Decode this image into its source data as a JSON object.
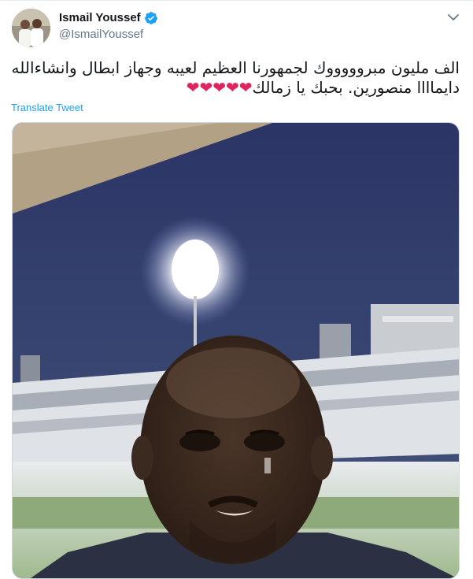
{
  "tweet": {
    "author": {
      "display_name": "Ismail Youssef",
      "handle": "@IsmailYoussef",
      "verified": true,
      "verified_icon": "verified-badge-icon"
    },
    "text_line1": "الف مليون مبروووووك لجمهورنا العظيم لعيبه وجهاز ابطال وانشاءالله",
    "text_line2": "دايماااا منصورين. بحبك يا زمالك",
    "hearts": "❤❤❤❤❤",
    "translate_label": "Translate Tweet",
    "menu_icon": "chevron-down-icon"
  },
  "colors": {
    "link": "#1da1f2",
    "secondary_text": "#657786",
    "heart": "#e0245e",
    "verified": "#1da1f2"
  }
}
